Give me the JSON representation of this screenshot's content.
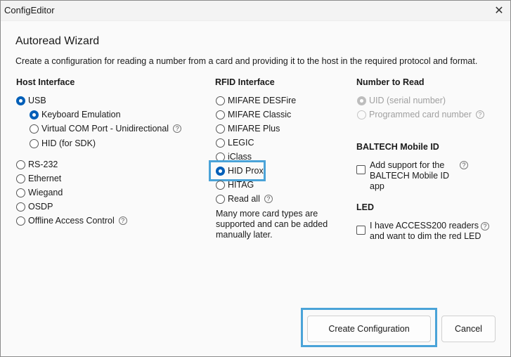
{
  "window": {
    "title": "ConfigEditor",
    "close_label": "✕"
  },
  "wizard": {
    "heading": "Autoread Wizard",
    "description": "Create a configuration for reading a number from a card and providing it to the host in the required protocol and format."
  },
  "host_interface": {
    "title": "Host Interface",
    "usb_label": "USB",
    "usb_options": [
      {
        "label": "Keyboard Emulation",
        "checked": true
      },
      {
        "label": "Virtual COM Port - Unidirectional",
        "checked": false,
        "help": true
      },
      {
        "label": "HID (for SDK)",
        "checked": false
      }
    ],
    "others": [
      {
        "label": "RS-232"
      },
      {
        "label": "Ethernet"
      },
      {
        "label": "Wiegand"
      },
      {
        "label": "OSDP"
      },
      {
        "label": "Offline Access Control",
        "help": true
      }
    ]
  },
  "rfid_interface": {
    "title": "RFID Interface",
    "options": [
      {
        "label": "MIFARE DESFire",
        "checked": false
      },
      {
        "label": "MIFARE Classic",
        "checked": false
      },
      {
        "label": "MIFARE Plus",
        "checked": false
      },
      {
        "label": "LEGIC",
        "checked": false
      },
      {
        "label": "iClass",
        "checked": false
      },
      {
        "label": "HID Prox",
        "checked": true
      },
      {
        "label": "HITAG",
        "checked": false
      },
      {
        "label": "Read all",
        "checked": false,
        "help": true
      }
    ],
    "note": "Many more card types are supported and can be added manually later."
  },
  "number_to_read": {
    "title": "Number to Read",
    "options": [
      {
        "label": "UID (serial number)",
        "checked": true,
        "disabled": true
      },
      {
        "label": "Programmed card number",
        "checked": false,
        "disabled": true,
        "help": true
      }
    ]
  },
  "mobile_id": {
    "title": "BALTECH Mobile ID",
    "checkbox_label": "Add support for the BALTECH Mobile ID app"
  },
  "led": {
    "title": "LED",
    "checkbox_label": "I have ACCESS200 readers and want to dim the red LED"
  },
  "buttons": {
    "create_label": "Create Configuration",
    "cancel_label": "Cancel"
  },
  "icons": {
    "help": "?",
    "accent_color": "#005fb8",
    "highlight_color": "#4aa3d8"
  }
}
